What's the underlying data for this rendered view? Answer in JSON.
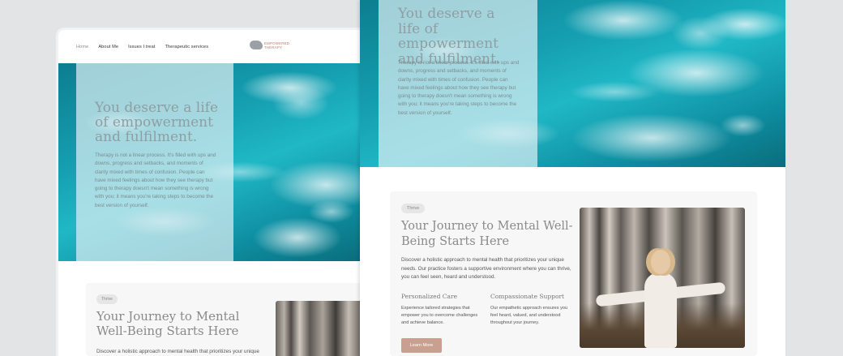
{
  "left_mockup": {
    "nav": {
      "items": [
        {
          "label": "Home"
        },
        {
          "label": "About Me"
        },
        {
          "label": "Issues I treat"
        },
        {
          "label": "Therapeutic services"
        }
      ],
      "logo_text_line1": "EMPOWERED",
      "logo_text_line2": "THERAPY"
    },
    "hero": {
      "title": "You deserve a life of empowerment and fulfilment.",
      "body": "Therapy is not a linear process. It's filled with ups and downs, progress and setbacks, and moments of clarity mixed with times of confusion. People can have mixed feelings about how they see therapy but going to therapy doesn't mean something is wrong with you; it means you're taking steps to become the best version of yourself."
    },
    "section": {
      "badge": "Thrive",
      "heading": "Your Journey to Mental Well-Being Starts Here",
      "description": "Discover a holistic approach to mental health that prioritizes your unique"
    }
  },
  "right_mockup": {
    "hero": {
      "title": "You deserve a life of empowerment and fulfilment.",
      "body": "Therapy is not a linear process. It's filled with ups and downs, progress and setbacks, and moments of clarity mixed with times of confusion. People can have mixed feelings about how they see therapy but going to therapy doesn't mean something is wrong with you; it means you're taking steps to become the best version of yourself."
    },
    "section": {
      "badge": "Thrive",
      "heading": "Your Journey to Mental Well-Being Starts Here",
      "description": "Discover a holistic approach to mental health that prioritizes your unique needs. Our practice fosters a supportive environment where you can thrive, you can feel seen, heard and understood.",
      "features": [
        {
          "title": "Personalized Care",
          "desc": "Experience tailored strategies that empower you to overcome challenges and achieve balance."
        },
        {
          "title": "Compassionate Support",
          "desc": "Our empathetic approach ensures you feel heard, valued, and understood throughout your journey."
        }
      ],
      "button_label": "Learn More"
    }
  },
  "colors": {
    "background": "#e3e4e6",
    "ocean": "#159fb1",
    "accent_button": "#c9a08f",
    "logo_text": "#c07b6b"
  }
}
